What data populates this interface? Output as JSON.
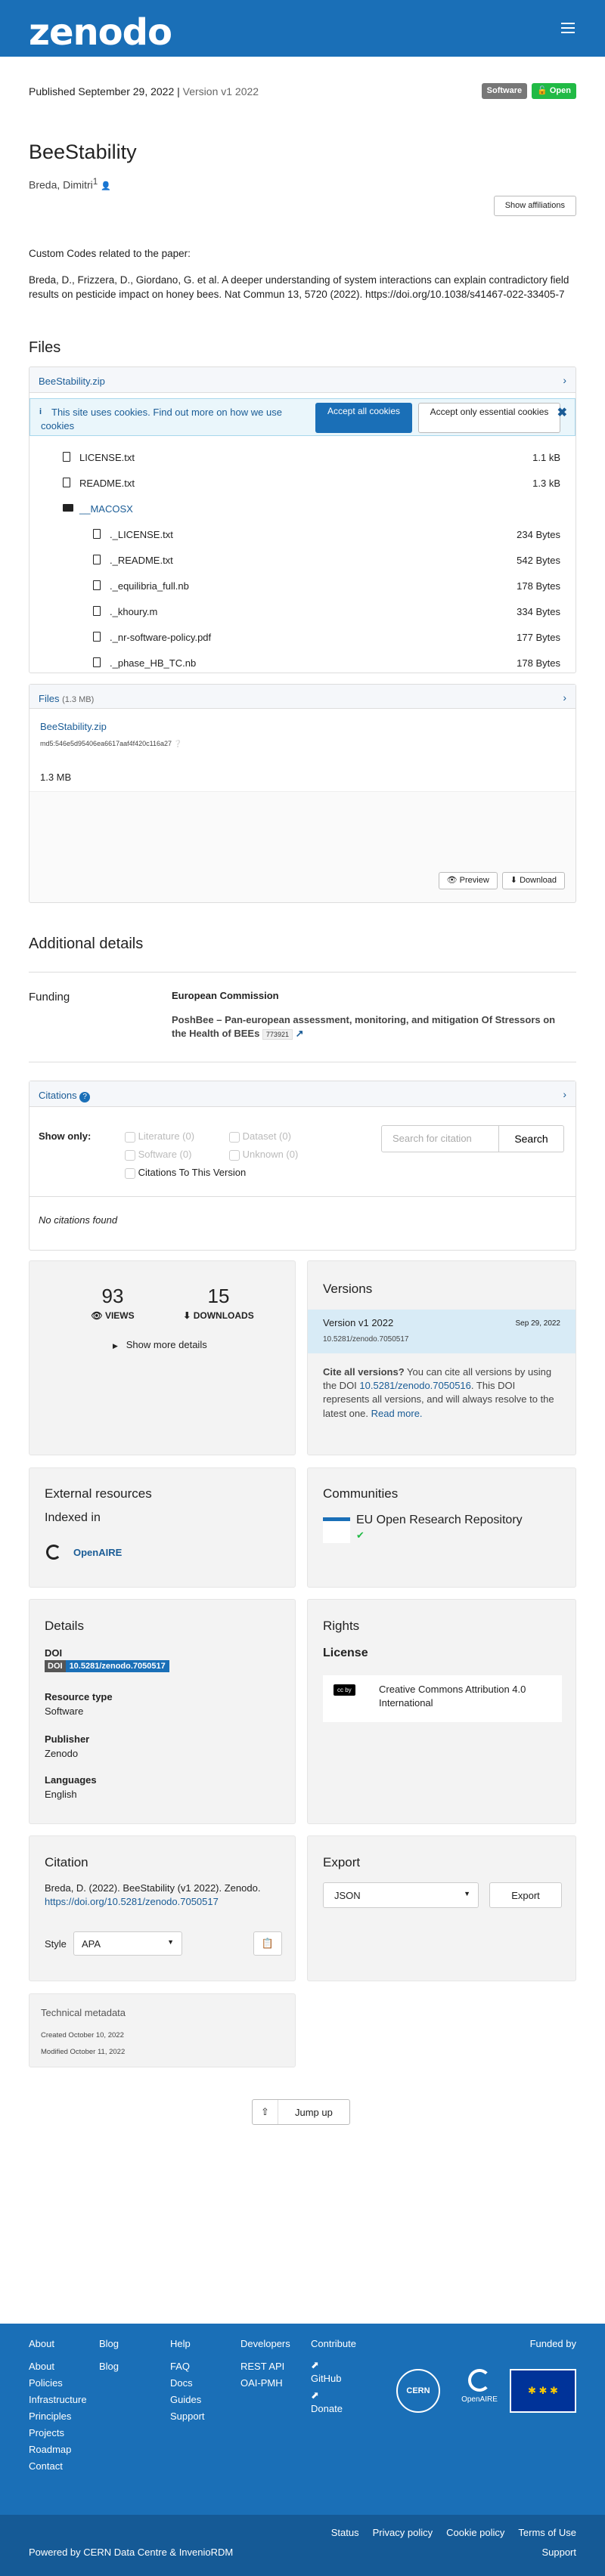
{
  "header": {
    "logo": "zenodo"
  },
  "record": {
    "published": "Published September 29, 2022",
    "version": "Version v1 2022",
    "badges": {
      "type": "Software",
      "access": "Open"
    },
    "title": "BeeStability",
    "creator": "Breda, Dimitri",
    "creator_sup": "1",
    "show_affiliations": "Show affiliations",
    "description": [
      "Custom Codes related to the paper:",
      "Breda, D., Frizzera, D., Giordano, G. et al. A deeper understanding of system interactions can explain contradictory field results on pesticide impact on honey bees. Nat Commun 13, 5720 (2022). https://doi.org/10.1038/s41467-022-33405-7"
    ]
  },
  "files": {
    "heading": "Files",
    "archive_name": "BeeStability.zip",
    "cookie": {
      "text": "This site uses cookies. Find out more on how we use cookies",
      "accept_all": "Accept all cookies",
      "accept_essential": "Accept only essential cookies"
    },
    "tree": [
      {
        "name": "LICENSE.txt",
        "size": "1.1 kB",
        "kind": "file",
        "level": 1
      },
      {
        "name": "README.txt",
        "size": "1.3 kB",
        "kind": "file",
        "level": 1
      },
      {
        "name": "__MACOSX",
        "size": "",
        "kind": "folder",
        "level": 1
      },
      {
        "name": "._LICENSE.txt",
        "size": "234 Bytes",
        "kind": "file",
        "level": 2
      },
      {
        "name": "._README.txt",
        "size": "542 Bytes",
        "kind": "file",
        "level": 2
      },
      {
        "name": "._equilibria_full.nb",
        "size": "178 Bytes",
        "kind": "file",
        "level": 2
      },
      {
        "name": "._khoury.m",
        "size": "334 Bytes",
        "kind": "file",
        "level": 2
      },
      {
        "name": "._nr-software-policy.pdf",
        "size": "177 Bytes",
        "kind": "file",
        "level": 2
      },
      {
        "name": "._phase_HB_TC.nb",
        "size": "178 Bytes",
        "kind": "file",
        "level": 2
      }
    ],
    "panel_label": "Files",
    "panel_size": "(1.3 MB)",
    "file_link": "BeeStability.zip",
    "md5": "md5:546e5d95406ea6617aaf4f420c116a27",
    "file_size": "1.3 MB",
    "preview": "Preview",
    "download": "Download"
  },
  "additional": {
    "heading": "Additional details",
    "funding_label": "Funding",
    "funder": "European Commission",
    "grant": "PoshBee – Pan-european assessment, monitoring, and mitigation Of Stressors on the Health of BEEs",
    "grant_id": "773921"
  },
  "citations": {
    "label": "Citations",
    "show_only": "Show only:",
    "filters": [
      "Literature (0)",
      "Dataset (0)",
      "Software (0)",
      "Unknown (0)"
    ],
    "this_version": "Citations To This Version",
    "search_placeholder": "Search for citation",
    "search_btn": "Search",
    "empty": "No citations found"
  },
  "stats": {
    "views": "93",
    "views_label": "VIEWS",
    "downloads": "15",
    "downloads_label": "DOWNLOADS",
    "more": "Show more details"
  },
  "versions": {
    "heading": "Versions",
    "item_label": "Version v1 2022",
    "item_date": "Sep 29, 2022",
    "item_doi": "10.5281/zenodo.7050517",
    "cite_bold": "Cite all versions?",
    "cite_a": " You can cite all versions by using the DOI ",
    "cite_doi": "10.5281/zenodo.7050516",
    "cite_b": ". This DOI represents all versions, and will always resolve to the latest one. ",
    "read_more": "Read more."
  },
  "external": {
    "heading": "External resources",
    "indexed": "Indexed in",
    "openaire": "OpenAIRE"
  },
  "communities": {
    "heading": "Communities",
    "name": "EU Open Research Repository"
  },
  "details": {
    "heading": "Details",
    "doi_label": "DOI",
    "doi_tag": "DOI",
    "doi_value": "10.5281/zenodo.7050517",
    "type_label": "Resource type",
    "type_value": "Software",
    "publisher_label": "Publisher",
    "publisher_value": "Zenodo",
    "lang_label": "Languages",
    "lang_value": "English"
  },
  "rights": {
    "heading": "Rights",
    "license_label": "License",
    "cc_badge": "cc by",
    "license": "Creative Commons Attribution 4.0 International"
  },
  "citation": {
    "heading": "Citation",
    "text": "Breda, D. (2022). BeeStability (v1 2022). Zenodo.",
    "link": "https://doi.org/10.5281/zenodo.7050517",
    "style_label": "Style",
    "style_value": "APA"
  },
  "export": {
    "heading": "Export",
    "format": "JSON",
    "button": "Export"
  },
  "technical": {
    "heading": "Technical metadata",
    "created": "Created October 10, 2022",
    "modified": "Modified October 11, 2022"
  },
  "jump_up": "Jump up",
  "footer": {
    "about": {
      "title": "About",
      "items": [
        "About",
        "Policies",
        "Infrastructure",
        "Principles",
        "Projects",
        "Roadmap",
        "Contact"
      ]
    },
    "blog": {
      "title": "Blog",
      "items": [
        "Blog"
      ]
    },
    "help": {
      "title": "Help",
      "items": [
        "FAQ",
        "Docs",
        "Guides",
        "Support"
      ]
    },
    "dev": {
      "title": "Developers",
      "items": [
        "REST API",
        "OAI-PMH"
      ]
    },
    "contribute": {
      "title": "Contribute",
      "items": [
        "GitHub",
        "Donate"
      ]
    },
    "funded_by": "Funded by",
    "cern": "CERN",
    "openaire": "OpenAIRE",
    "powered": "Powered by CERN Data Centre & InvenioRDM",
    "links": [
      "Status",
      "Privacy policy",
      "Cookie policy",
      "Terms of Use"
    ],
    "support": "Support"
  },
  "colors": {
    "brand": "#1a6fb7",
    "open": "#21ba45",
    "link": "#1a5c96"
  }
}
